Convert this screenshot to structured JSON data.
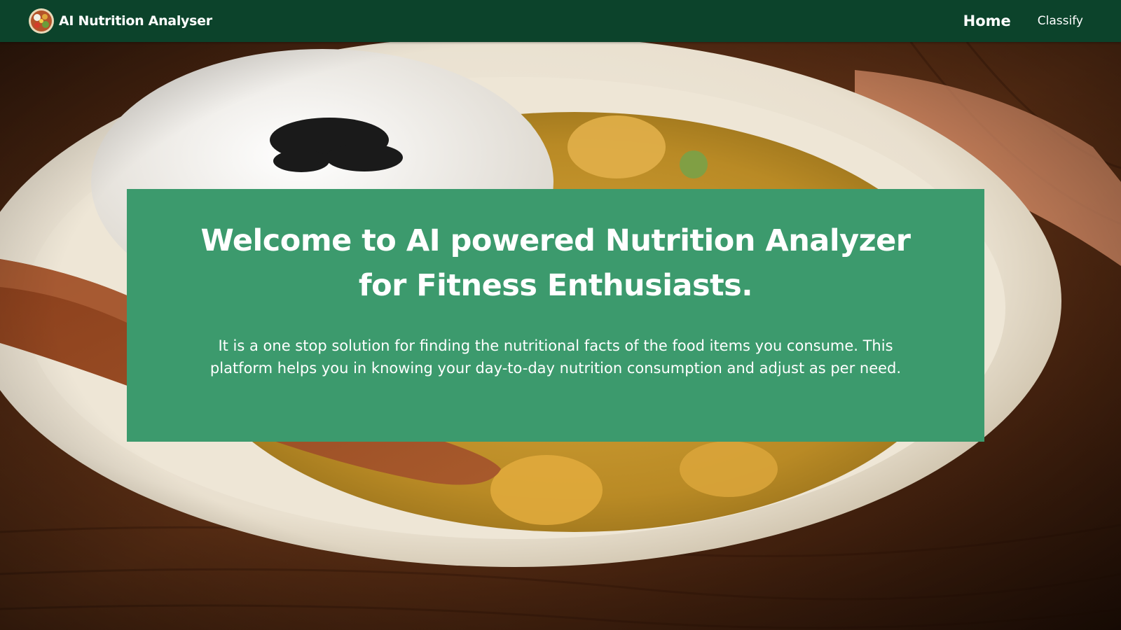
{
  "navbar": {
    "brand_name": "AI Nutrition Analyser",
    "logo_icon": "food-bowl-icon",
    "links": [
      {
        "label": "Home",
        "active": true
      },
      {
        "label": "Classify",
        "active": false
      }
    ]
  },
  "hero": {
    "background": "food-plate-photo",
    "title": "Welcome to AI powered Nutrition Analyzer for Fitness Enthusiasts.",
    "description": "It is a one stop solution for finding the nutritional facts of the food items you consume. This platform helps you in knowing your day-to-day nutrition consumption and adjust as per need."
  },
  "colors": {
    "navbar": "#0c432b",
    "card": "#3c9a6d",
    "text": "#ffffff"
  }
}
